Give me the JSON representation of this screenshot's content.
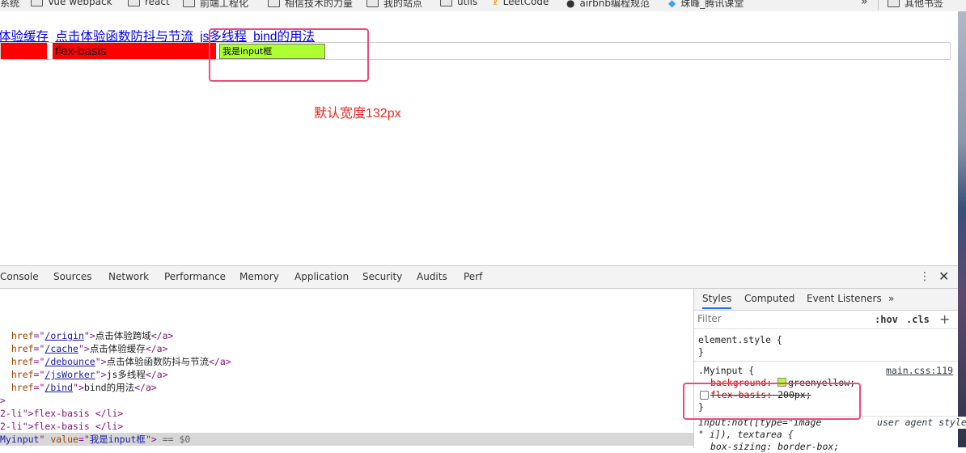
{
  "bookmarks": {
    "items": [
      {
        "label": "系统",
        "icon": "none"
      },
      {
        "label": "Vue webpack",
        "icon": "folder-icon"
      },
      {
        "label": "react",
        "icon": "folder-icon"
      },
      {
        "label": "前端工程化",
        "icon": "folder-icon"
      },
      {
        "label": "相信技术的力量",
        "icon": "folder-icon"
      },
      {
        "label": "我的站点",
        "icon": "folder-icon"
      },
      {
        "label": "utils",
        "icon": "folder-icon"
      },
      {
        "label": "LeetCode",
        "icon": "leetcode-icon"
      },
      {
        "label": "airbnb编程规范",
        "icon": "github-icon"
      },
      {
        "label": "珠峰_腾讯课堂",
        "icon": "tencent-icon"
      }
    ],
    "more": "»",
    "other": "其他书签"
  },
  "page": {
    "links": [
      "体验缓存",
      "点击体验函数防抖与节流",
      "js多线程",
      "bind的用法"
    ],
    "li_text": "flex-basis",
    "input_value": "我是input框",
    "annotation": "默认宽度132px"
  },
  "devtools": {
    "tabs": [
      "Console",
      "Sources",
      "Network",
      "Performance",
      "Memory",
      "Application",
      "Security",
      "Audits",
      "Perf"
    ],
    "elements_lines": [
      {
        "href": "/origin",
        "text": "点击体验跨域"
      },
      {
        "href": "/cache",
        "text": "点击体验缓存"
      },
      {
        "href": "/debounce",
        "text": "点击体验函数防抖与节流"
      },
      {
        "href": "/jsWorker",
        "text": "js多线程"
      },
      {
        "href": "/bind",
        "text": "bind的用法"
      }
    ],
    "li_lines": [
      "2-li\">flex-basis </li>",
      "2-li\">flex-basis </li>"
    ],
    "selected_line": {
      "cls": "Myinput",
      "value": "我是input框",
      "suffix": "== $0"
    },
    "styles": {
      "tabs": [
        "Styles",
        "Computed",
        "Event Listeners",
        "»"
      ],
      "filter_placeholder": "Filter",
      "hov": ":hov",
      "cls": ".cls",
      "element_style": "element.style {",
      "close_brace": "}",
      "myinput_selector": ".Myinput {",
      "myinput_source": "main.css:119",
      "background_prop": "background:",
      "background_value": "greenyellow;",
      "flex_basis_prop": "flex-basis:",
      "flex_basis_value": "200px;",
      "ua_selector": "input:not([type=\"image",
      "ua_selector2": "\" i]), textarea {",
      "ua_label": "user agent stylesheet",
      "box_sizing": "box-sizing: border-box;"
    }
  },
  "colors": {
    "highlight": "#ee4b7a",
    "red": "#ff0000",
    "greenyellow": "#adff2f",
    "link": "#0000ee",
    "annotation": "#e8291c"
  }
}
